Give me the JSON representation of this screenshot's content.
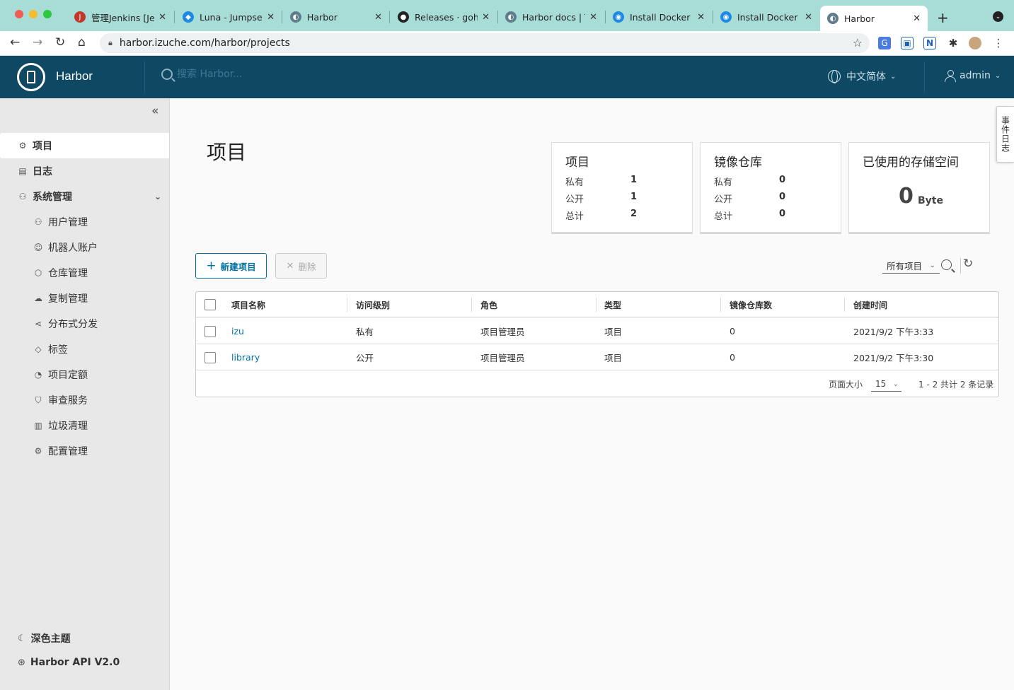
{
  "browser": {
    "tabs": [
      {
        "label": "管理Jenkins [Je",
        "color": "#c0392b"
      },
      {
        "label": "Luna - Jumpser",
        "color": "#1e88e5"
      },
      {
        "label": "Harbor",
        "color": "#607d8b"
      },
      {
        "label": "Releases · goh",
        "color": "#222222"
      },
      {
        "label": "Harbor docs | T",
        "color": "#607d8b"
      },
      {
        "label": "Install Docker C",
        "color": "#1e88e5"
      },
      {
        "label": "Install Docker E",
        "color": "#1e88e5"
      },
      {
        "label": "Harbor",
        "color": "#607d8b"
      }
    ],
    "url": "harbor.izuche.com/harbor/projects"
  },
  "header": {
    "app_name": "Harbor",
    "search_placeholder": "搜索 Harbor...",
    "language": "中文简体",
    "user": "admin"
  },
  "sidebar": {
    "items": [
      {
        "label": "项目",
        "icon": "project-icon",
        "glyph": "⚙"
      },
      {
        "label": "日志",
        "icon": "log-icon",
        "glyph": "▤"
      },
      {
        "label": "系统管理",
        "icon": "admin-icon",
        "glyph": "⚇"
      }
    ],
    "sub_items": [
      {
        "label": "用户管理",
        "icon": "users-icon",
        "glyph": "⚇"
      },
      {
        "label": "机器人账户",
        "icon": "robot-icon",
        "glyph": "☺"
      },
      {
        "label": "仓库管理",
        "icon": "registry-icon",
        "glyph": "⬡"
      },
      {
        "label": "复制管理",
        "icon": "replication-icon",
        "glyph": "☁"
      },
      {
        "label": "分布式分发",
        "icon": "distribution-icon",
        "glyph": "⋖"
      },
      {
        "label": "标签",
        "icon": "tag-icon",
        "glyph": "◇"
      },
      {
        "label": "项目定额",
        "icon": "quota-icon",
        "glyph": "◔"
      },
      {
        "label": "审查服务",
        "icon": "scanner-icon",
        "glyph": "⛉"
      },
      {
        "label": "垃圾清理",
        "icon": "trash-icon",
        "glyph": "▥"
      },
      {
        "label": "配置管理",
        "icon": "config-icon",
        "glyph": "⚙"
      }
    ],
    "dark_theme": "深色主题",
    "api_link": "Harbor API V2.0"
  },
  "main": {
    "title": "项目",
    "cards": {
      "projects": {
        "title": "项目",
        "private_label": "私有",
        "private": "1",
        "public_label": "公开",
        "public": "1",
        "total_label": "总计",
        "total": "2"
      },
      "repos": {
        "title": "镜像仓库",
        "private_label": "私有",
        "private": "0",
        "public_label": "公开",
        "public": "0",
        "total_label": "总计",
        "total": "0"
      },
      "storage": {
        "title": "已使用的存储空间",
        "value": "0",
        "unit": "Byte"
      }
    },
    "new_button": "新建项目",
    "delete_button": "删除",
    "filter": "所有项目",
    "columns": [
      "项目名称",
      "访问级别",
      "角色",
      "类型",
      "镜像仓库数",
      "创建时间"
    ],
    "rows": [
      {
        "name": "izu",
        "access": "私有",
        "role": "项目管理员",
        "type": "项目",
        "repos": "0",
        "created": "2021/9/2 下午3:33"
      },
      {
        "name": "library",
        "access": "公开",
        "role": "项目管理员",
        "type": "项目",
        "repos": "0",
        "created": "2021/9/2 下午3:30"
      }
    ],
    "page_size_label": "页面大小",
    "page_size": "15",
    "count": "1 - 2 共计 2 条记录"
  },
  "event_log": "事件日志"
}
